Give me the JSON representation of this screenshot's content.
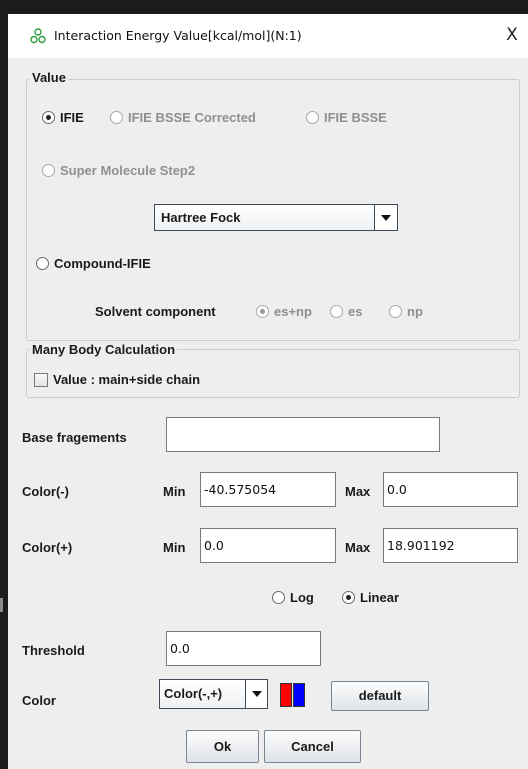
{
  "window": {
    "title": "Interaction Energy Value[kcal/mol](N:1)",
    "close_label": "X",
    "app_icon": "molecule-network-icon"
  },
  "value_group": {
    "title": "Value",
    "radios": [
      {
        "label": "IFIE",
        "selected": true,
        "enabled": true
      },
      {
        "label": "IFIE BSSE Corrected",
        "selected": false,
        "enabled": false
      },
      {
        "label": "IFIE BSSE",
        "selected": false,
        "enabled": false
      }
    ],
    "super_molecule": {
      "label": "Super Molecule Step2",
      "selected": false,
      "enabled": false
    },
    "method_select": {
      "value": "Hartree Fock"
    },
    "compound": {
      "label": "Compound-IFIE",
      "selected": false,
      "enabled": true
    },
    "solvent": {
      "label": "Solvent component",
      "options": [
        {
          "label": "es+np",
          "selected": true
        },
        {
          "label": "es",
          "selected": false
        },
        {
          "label": "np",
          "selected": false
        }
      ]
    }
  },
  "many_body_group": {
    "title": "Many Body Calculation",
    "checkbox_label": "Value : main+side chain",
    "checked": false
  },
  "base_fragments": {
    "label": "Base fragements",
    "value": ""
  },
  "color_minus": {
    "label": "Color(-)",
    "min_label": "Min",
    "min_value": "-40.575054",
    "max_label": "Max",
    "max_value": "0.0"
  },
  "color_plus": {
    "label": "Color(+)",
    "min_label": "Min",
    "min_value": "0.0",
    "max_label": "Max",
    "max_value": "18.901192"
  },
  "scale": {
    "options": [
      {
        "label": "Log",
        "selected": false
      },
      {
        "label": "Linear",
        "selected": true
      }
    ]
  },
  "threshold": {
    "label": "Threshold",
    "value": "0.0"
  },
  "color": {
    "label": "Color",
    "select_value": "Color(-,+)",
    "swatch_colors": [
      "#ff0000",
      "#0000ff"
    ],
    "default_label": "default"
  },
  "footer": {
    "ok_label": "Ok",
    "cancel_label": "Cancel"
  }
}
